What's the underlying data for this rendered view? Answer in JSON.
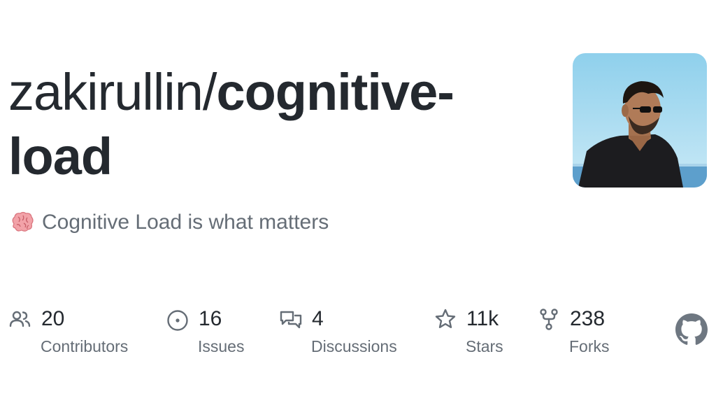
{
  "repo": {
    "owner": "zakirullin",
    "separator": "/",
    "name_part1": "cognitive-",
    "name_part2": "load",
    "description": "Cognitive Load is what matters",
    "description_emoji": "brain-icon"
  },
  "stats": [
    {
      "value": "20",
      "label": "Contributors",
      "icon": "people-icon"
    },
    {
      "value": "16",
      "label": "Issues",
      "icon": "issue-opened-icon"
    },
    {
      "value": "4",
      "label": "Discussions",
      "icon": "comment-discussion-icon"
    },
    {
      "value": "11k",
      "label": "Stars",
      "icon": "star-icon"
    },
    {
      "value": "238",
      "label": "Forks",
      "icon": "repo-forked-icon"
    }
  ],
  "colors": {
    "text_primary": "#24292f",
    "text_secondary": "#656d76",
    "brain": "#f0a4a8"
  },
  "logo": "github-mark-icon"
}
